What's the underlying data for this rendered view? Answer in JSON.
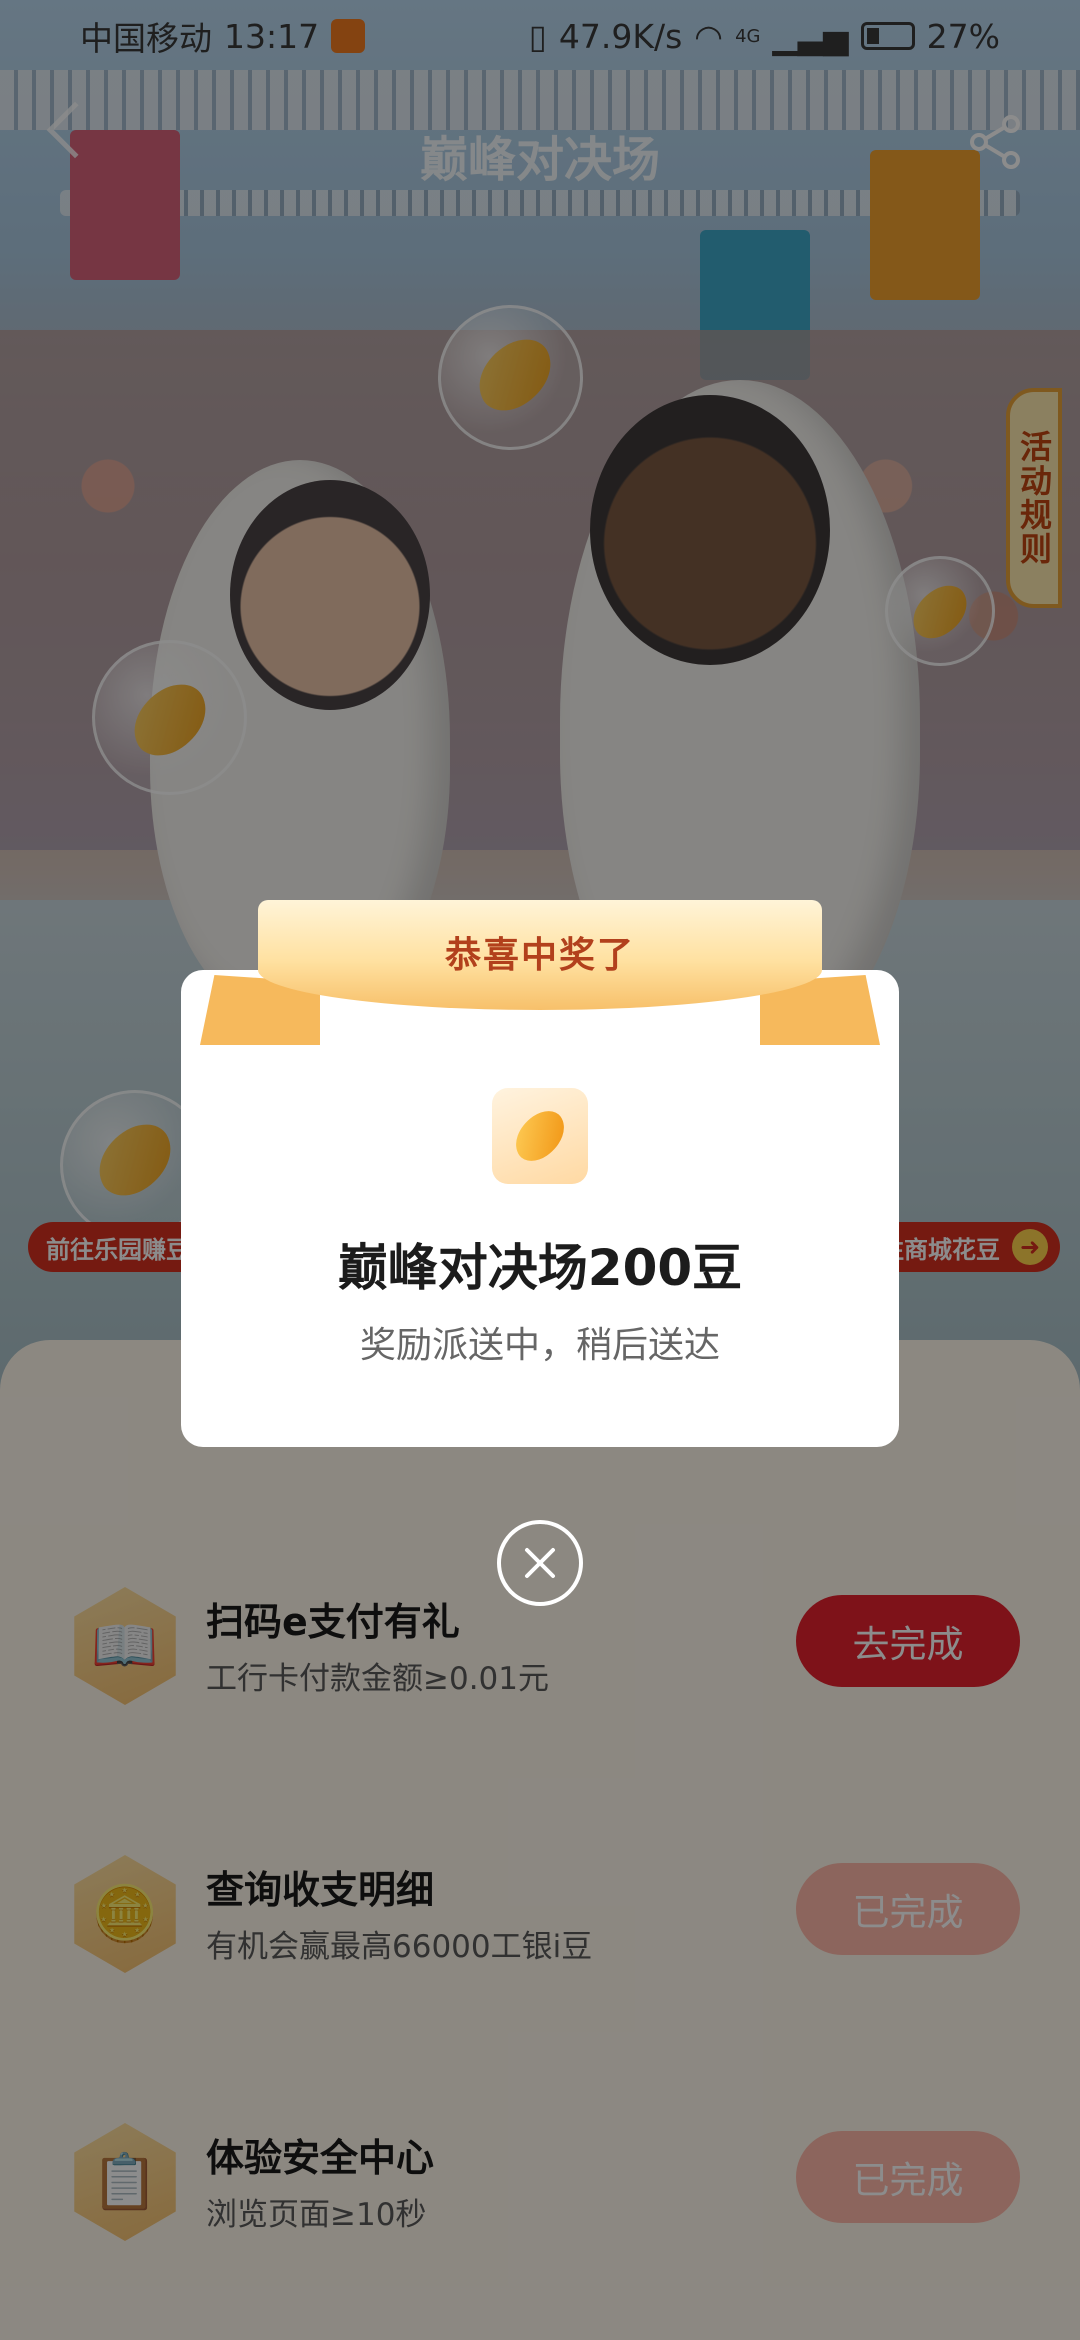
{
  "status_bar": {
    "carrier": "中国移动",
    "time": "13:17",
    "speed": "47.9K/s",
    "network": "4G",
    "battery": "27%"
  },
  "header": {
    "title": "巅峰对决场"
  },
  "rules_tab": {
    "label": "活动规则"
  },
  "promo": {
    "left_pill": "前往乐园赚豆",
    "right_pill": "往商城花豆"
  },
  "modal": {
    "banner": "恭喜中奖了",
    "title": "巅峰对决场200豆",
    "subtitle": "奖励派送中，稍后送达"
  },
  "tasks": [
    {
      "title": "扫码e支付有礼",
      "subtitle": "工行卡付款金额≥0.01元",
      "button": "去完成",
      "state": "todo",
      "icon": "book-icon"
    },
    {
      "title": "查询收支明细",
      "subtitle": "有机会赢最高66000工银i豆",
      "button": "已完成",
      "state": "done",
      "icon": "coin-pile-icon"
    },
    {
      "title": "体验安全中心",
      "subtitle": "浏览页面≥10秒",
      "button": "已完成",
      "state": "done",
      "icon": "clipboard-icon"
    }
  ],
  "colors": {
    "primary_red": "#e5222e",
    "done_pink": "#ffb9a9",
    "ribbon_gold": "#f7c06a",
    "ribbon_text": "#b2401c"
  }
}
